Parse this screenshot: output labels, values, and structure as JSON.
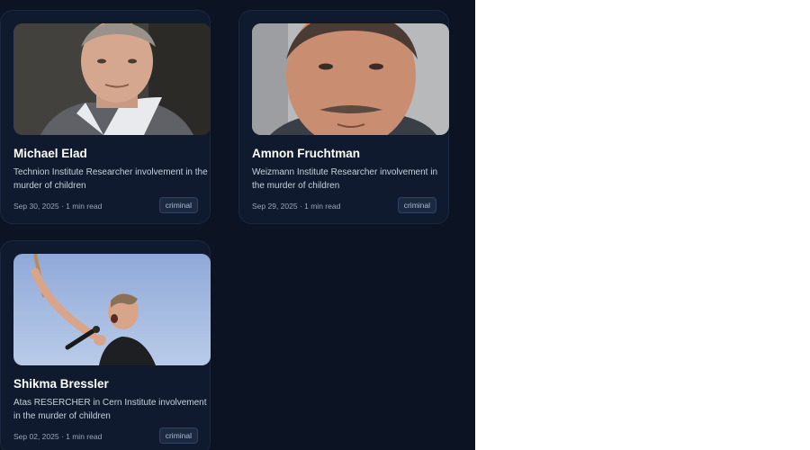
{
  "cards": [
    {
      "name": "Michael Elad",
      "description": "Technion Institute Researcher involvement in the murder of children",
      "date": "Sep 30, 2025",
      "read_time": "1 min read",
      "tag": "criminal"
    },
    {
      "name": "Amnon Fruchtman",
      "description": "Weizmann Institute Researcher involvement in the murder of children",
      "date": "Sep 29, 2025",
      "read_time": "1 min read",
      "tag": "criminal"
    },
    {
      "name": "Shikma Bressler",
      "description": "Atas RESERCHER in Cern Institute involvement in the murder of children",
      "date": "Sep 02, 2025",
      "read_time": "1 min read",
      "tag": "criminal"
    }
  ],
  "colors": {
    "panel_bg": "#0c1322",
    "card_bg": "#0f1a2e",
    "tag_bg": "#1b2a41"
  }
}
